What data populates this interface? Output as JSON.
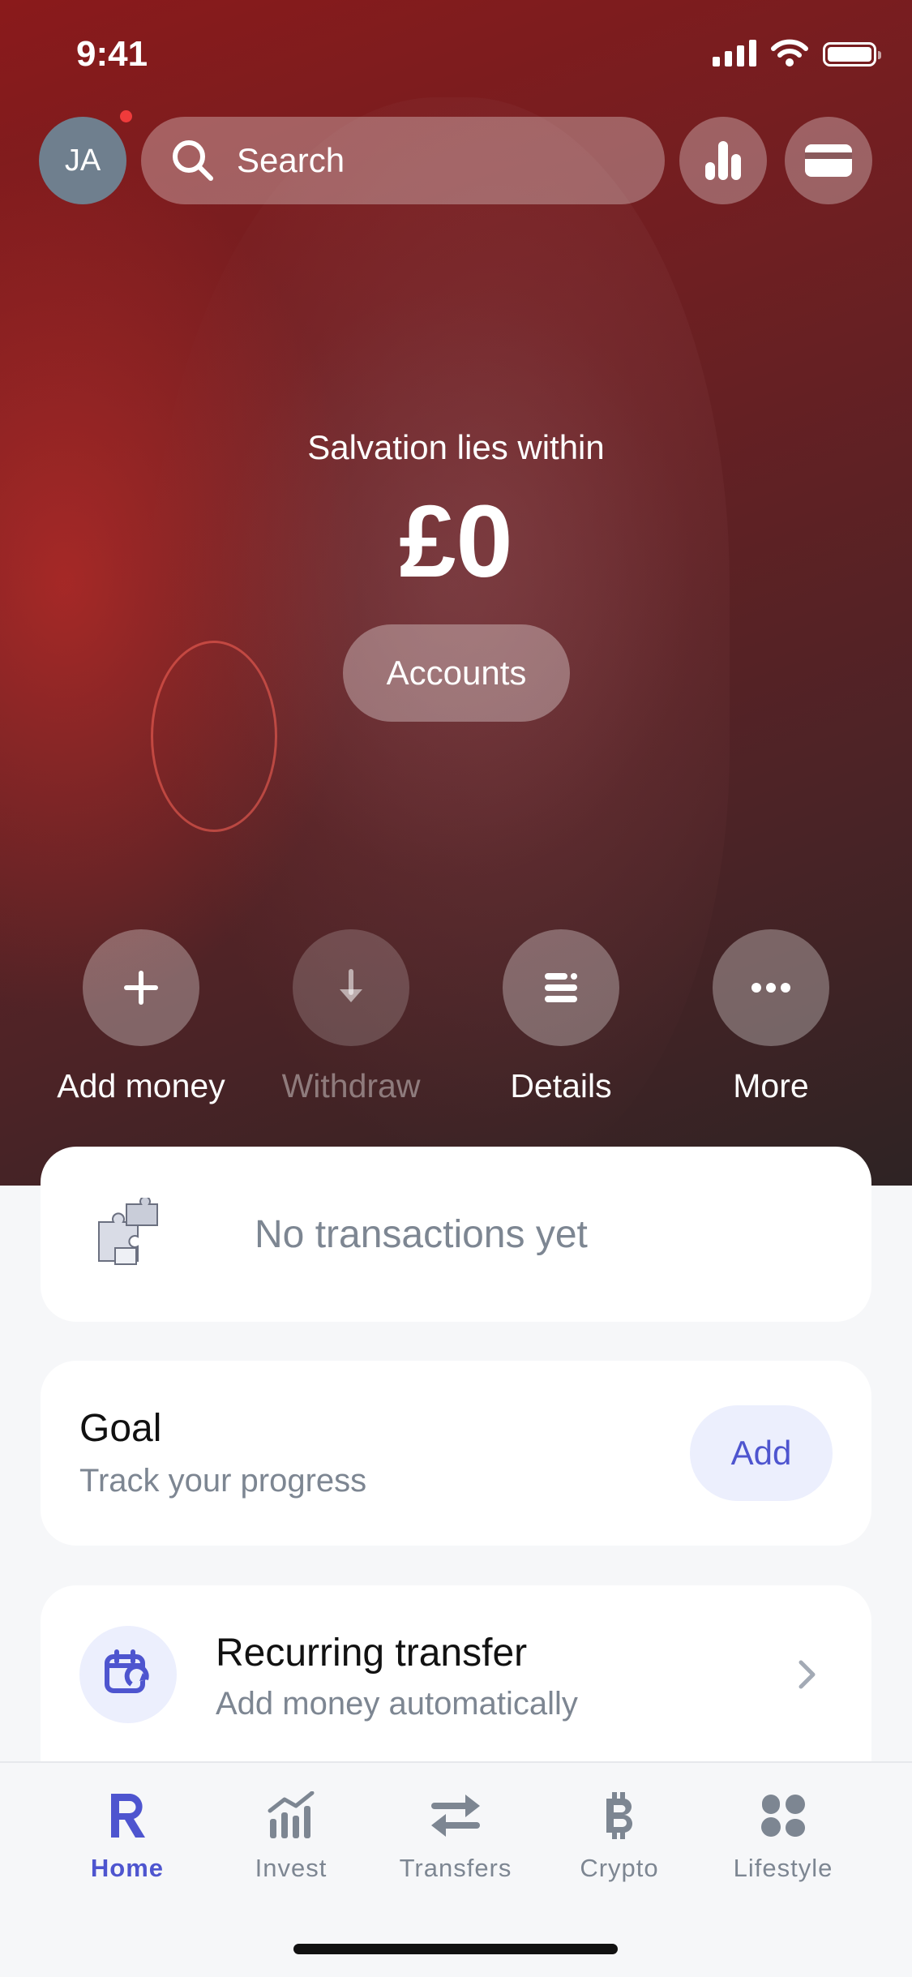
{
  "status_bar": {
    "time": "9:41"
  },
  "header": {
    "avatar_initials": "JA",
    "search_placeholder": "Search",
    "icons": [
      "search-icon",
      "analytics-icon",
      "card-icon"
    ]
  },
  "account": {
    "name": "Salvation lies within",
    "balance": "£0",
    "accounts_label": "Accounts"
  },
  "actions": [
    {
      "label": "Add money",
      "icon": "plus-icon",
      "enabled": true
    },
    {
      "label": "Withdraw",
      "icon": "arrow-down-icon",
      "enabled": false
    },
    {
      "label": "Details",
      "icon": "details-icon",
      "enabled": true
    },
    {
      "label": "More",
      "icon": "more-icon",
      "enabled": true
    }
  ],
  "transactions": {
    "empty_text": "No transactions yet"
  },
  "goal": {
    "title": "Goal",
    "subtitle": "Track your progress",
    "button": "Add"
  },
  "recurring": {
    "title": "Recurring transfer",
    "subtitle": "Add money automatically"
  },
  "tabs": [
    {
      "label": "Home",
      "icon": "revolut-r-icon",
      "active": true
    },
    {
      "label": "Invest",
      "icon": "invest-chart-icon",
      "active": false
    },
    {
      "label": "Transfers",
      "icon": "transfer-arrows-icon",
      "active": false
    },
    {
      "label": "Crypto",
      "icon": "bitcoin-icon",
      "active": false
    },
    {
      "label": "Lifestyle",
      "icon": "lifestyle-icon",
      "active": false
    }
  ],
  "colors": {
    "accent": "#4e55cf",
    "notification_dot": "#ef3b3b",
    "muted_text": "#7d8692"
  }
}
